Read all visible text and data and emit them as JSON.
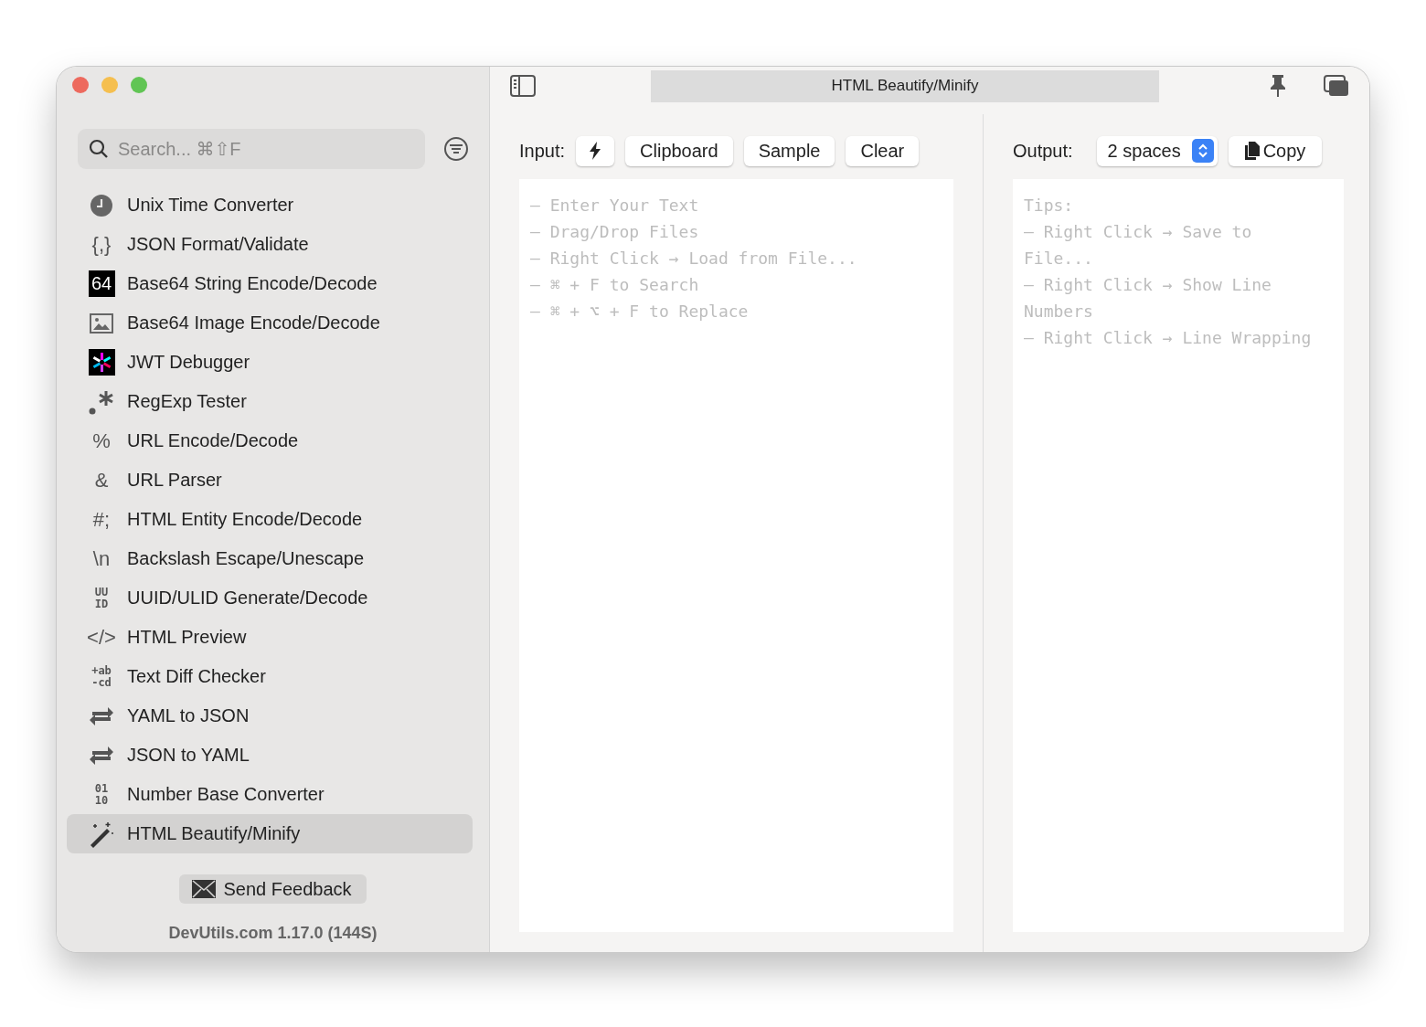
{
  "window": {
    "title": "HTML Beautify/Minify"
  },
  "sidebar": {
    "search": {
      "placeholder": "Search... ⌘⇧F"
    },
    "items": [
      {
        "label": "Unix Time Converter",
        "selected": false,
        "icon": {
          "kind": "clock"
        }
      },
      {
        "label": "JSON Format/Validate",
        "selected": false,
        "icon": {
          "kind": "glyph",
          "text": "{,}"
        }
      },
      {
        "label": "Base64 String Encode/Decode",
        "selected": false,
        "icon": {
          "kind": "badge",
          "text": "64"
        }
      },
      {
        "label": "Base64 Image Encode/Decode",
        "selected": false,
        "icon": {
          "kind": "photo"
        }
      },
      {
        "label": "JWT Debugger",
        "selected": false,
        "icon": {
          "kind": "jwt"
        }
      },
      {
        "label": "RegExp Tester",
        "selected": false,
        "icon": {
          "kind": "regex"
        }
      },
      {
        "label": "URL Encode/Decode",
        "selected": false,
        "icon": {
          "kind": "glyph",
          "text": "%"
        }
      },
      {
        "label": "URL Parser",
        "selected": false,
        "icon": {
          "kind": "glyph",
          "text": "&"
        }
      },
      {
        "label": "HTML Entity Encode/Decode",
        "selected": false,
        "icon": {
          "kind": "glyph",
          "text": "#;"
        }
      },
      {
        "label": "Backslash Escape/Unescape",
        "selected": false,
        "icon": {
          "kind": "glyph",
          "text": "\\n"
        }
      },
      {
        "label": "UUID/ULID Generate/Decode",
        "selected": false,
        "icon": {
          "kind": "stack",
          "lines": [
            "UU",
            "ID"
          ]
        }
      },
      {
        "label": "HTML Preview",
        "selected": false,
        "icon": {
          "kind": "glyph",
          "text": "</>"
        }
      },
      {
        "label": "Text Diff Checker",
        "selected": false,
        "icon": {
          "kind": "stack",
          "lines": [
            "+ab",
            "-cd"
          ]
        }
      },
      {
        "label": "YAML to JSON",
        "selected": false,
        "icon": {
          "kind": "swap"
        }
      },
      {
        "label": "JSON to YAML",
        "selected": false,
        "icon": {
          "kind": "swap"
        }
      },
      {
        "label": "Number Base Converter",
        "selected": false,
        "icon": {
          "kind": "stack",
          "lines": [
            "01",
            "10"
          ]
        }
      },
      {
        "label": "HTML Beautify/Minify",
        "selected": true,
        "icon": {
          "kind": "wand"
        }
      }
    ],
    "feedback_button": "Send Feedback",
    "version": "DevUtils.com 1.17.0 (144S)"
  },
  "input": {
    "label": "Input:",
    "buttons": [
      {
        "kind": "icon"
      },
      {
        "kind": "text",
        "label": "Clipboard"
      },
      {
        "kind": "text",
        "label": "Sample"
      },
      {
        "kind": "text",
        "label": "Clear"
      }
    ],
    "placeholder": [
      "– Enter Your Text",
      "– Drag/Drop Files",
      "– Right Click → Load from File...",
      "– ⌘ + F to Search",
      "– ⌘ + ⌥ + F to Replace"
    ]
  },
  "output": {
    "label": "Output:",
    "indent": "2 spaces",
    "copy_button": "Copy",
    "placeholder": [
      "Tips:",
      "– Right Click → Save to",
      "File...",
      "– Right Click → Show Line",
      "Numbers",
      "– Right Click → Line Wrapping"
    ]
  }
}
